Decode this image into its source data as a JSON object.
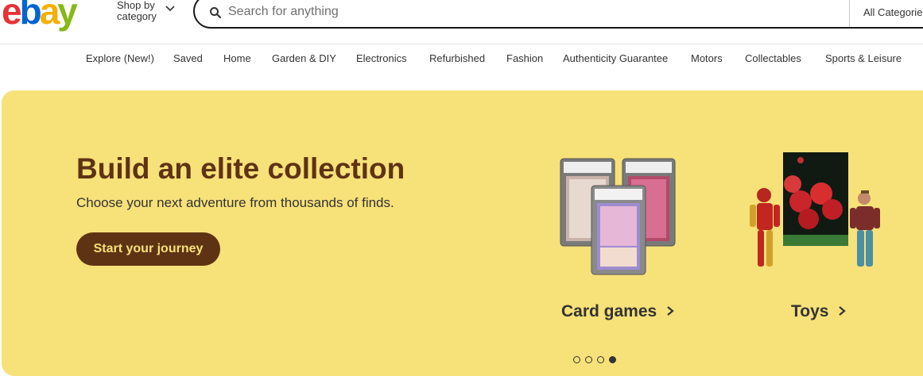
{
  "header": {
    "logo_letters": [
      "e",
      "b",
      "a",
      "y"
    ],
    "logo_colors": [
      "#e53238",
      "#0064d2",
      "#f5af02",
      "#86b817"
    ],
    "shop_by_category": "Shop by category",
    "search_placeholder": "Search for anything",
    "all_categories": "All Categorie"
  },
  "nav": {
    "items": [
      "Explore (New!)",
      "Saved",
      "Home",
      "Garden & DIY",
      "Electronics",
      "Refurbished",
      "Fashion",
      "Authenticity Guarantee",
      "Motors",
      "Collectables",
      "Sports & Leisure"
    ]
  },
  "hero": {
    "title": "Build an elite collection",
    "subtitle": "Choose your next adventure from thousands of finds.",
    "cta": "Start your journey",
    "background": "#f7e179",
    "accent": "#5e3314",
    "tiles": [
      {
        "label": "Card games",
        "icon": "chevron-right-icon"
      },
      {
        "label": "Toys",
        "icon": "chevron-right-icon"
      }
    ],
    "carousel": {
      "slide_count": 4,
      "active_index": 3
    }
  }
}
